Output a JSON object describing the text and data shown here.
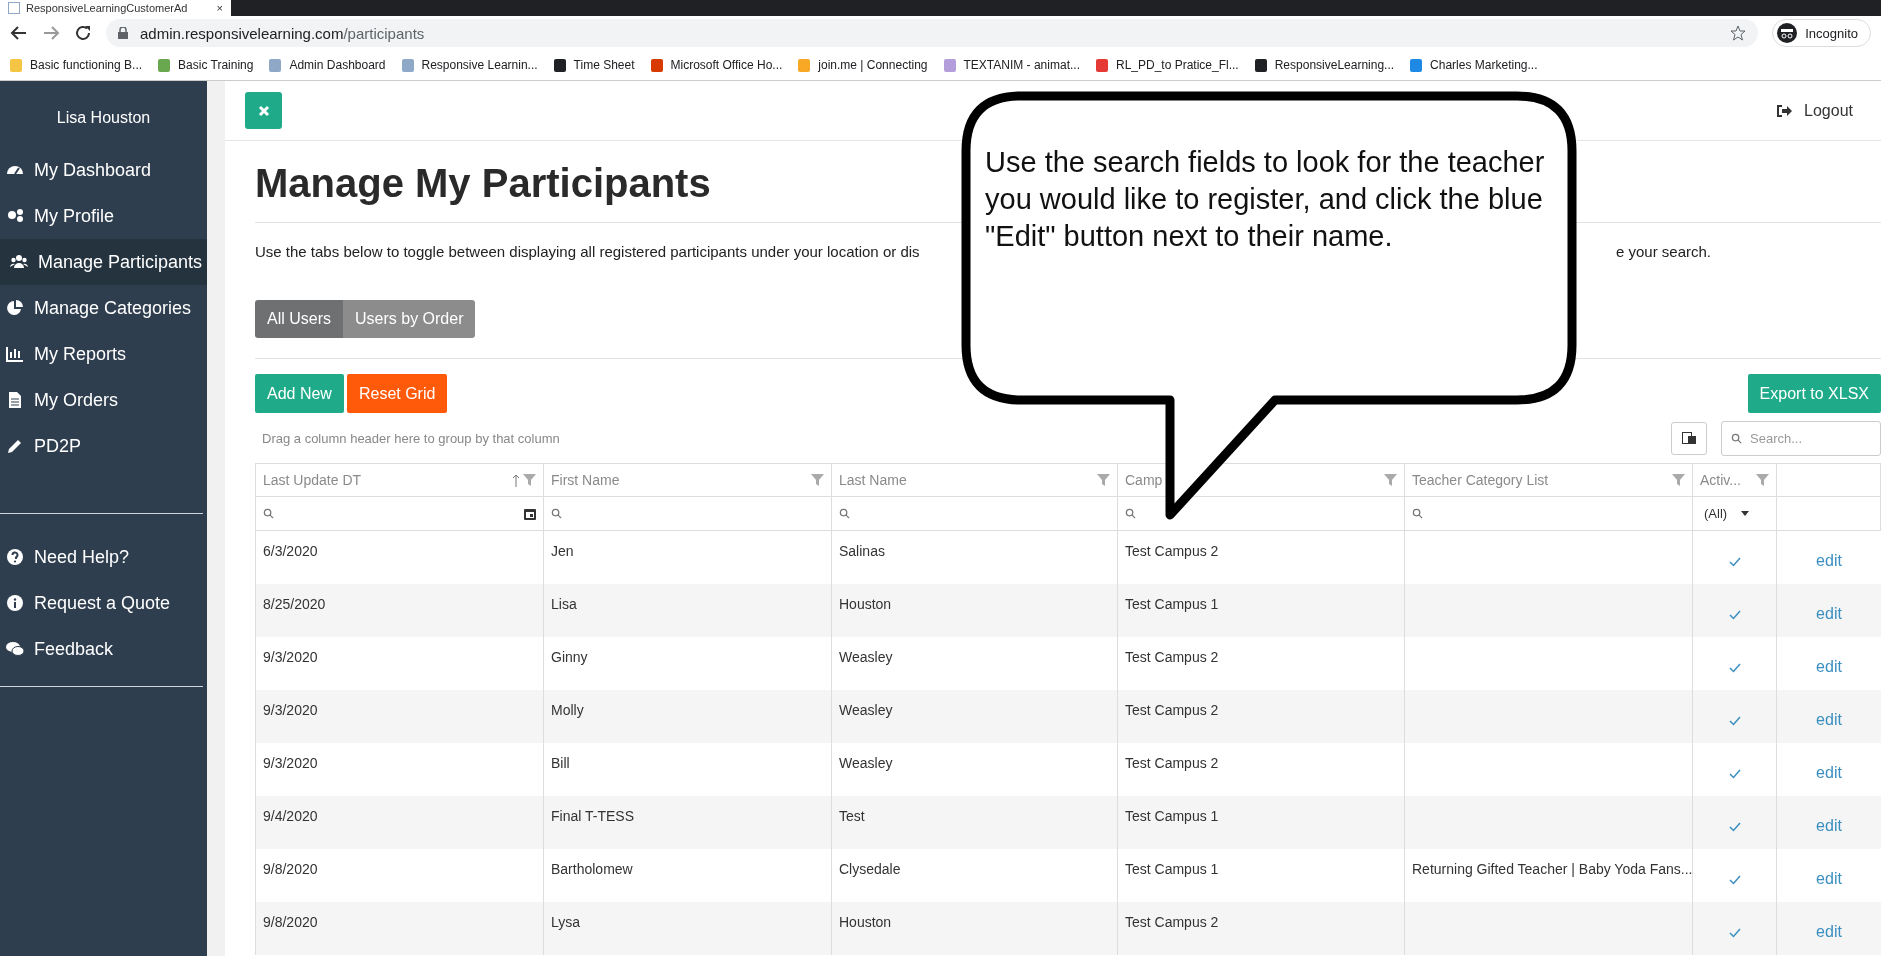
{
  "browser": {
    "tab_title": "ResponsiveLearningCustomerAd",
    "tab_close": "×",
    "url_host": "admin.responsivelearning.com",
    "url_path": "/participants",
    "profile": "Incognito",
    "bookmarks": [
      {
        "label": "Basic functioning B...",
        "color": "#f4c542"
      },
      {
        "label": "Basic Training",
        "color": "#6aa84f"
      },
      {
        "label": "Admin Dashboard",
        "color": "#8fa8c8"
      },
      {
        "label": "Responsive Learnin...",
        "color": "#8fa8c8"
      },
      {
        "label": "Time Sheet",
        "color": "#202124"
      },
      {
        "label": "Microsoft Office Ho...",
        "color": "#d83b01"
      },
      {
        "label": "join.me | Connecting",
        "color": "#f9a825"
      },
      {
        "label": "TEXTANIM - animat...",
        "color": "#b39ddb"
      },
      {
        "label": "RL_PD_to Pratice_Fl...",
        "color": "#e53935"
      },
      {
        "label": "ResponsiveLearning...",
        "color": "#202124"
      },
      {
        "label": "Charles Marketing...",
        "color": "#1e88e5"
      }
    ]
  },
  "sidebar": {
    "user": "Lisa Houston",
    "items": [
      {
        "label": "My Dashboard",
        "selected": false
      },
      {
        "label": "My Profile",
        "selected": false
      },
      {
        "label": "Manage Participants",
        "selected": true
      },
      {
        "label": "Manage Categories",
        "selected": false
      },
      {
        "label": "My Reports",
        "selected": false
      },
      {
        "label": "My Orders",
        "selected": false
      },
      {
        "label": "PD2P",
        "selected": false
      }
    ],
    "help_items": [
      {
        "label": "Need Help?"
      },
      {
        "label": "Request a Quote"
      },
      {
        "label": "Feedback"
      }
    ]
  },
  "header": {
    "logout": "Logout"
  },
  "page": {
    "title": "Manage My Participants",
    "intro_left": "Use the tabs below to toggle between displaying all registered participants under your location or dis",
    "intro_right": "e your search.",
    "tabs": [
      {
        "label": "All Users",
        "selected": true
      },
      {
        "label": "Users by Order",
        "selected": false
      }
    ],
    "buttons": {
      "add": "Add New",
      "reset": "Reset Grid",
      "export": "Export to XLSX"
    },
    "group_hint": "Drag a column header here to group by that column",
    "search_placeholder": "Search..."
  },
  "table": {
    "columns": [
      "Last Update DT",
      "First Name",
      "Last Name",
      "Camp",
      "Teacher Category List",
      "Activ..."
    ],
    "active_filter": "(All)",
    "rows": [
      {
        "date": "6/3/2020",
        "first": "Jen",
        "last": "Salinas",
        "campus": "Test Campus 2",
        "categories": "",
        "active": true,
        "action": "edit"
      },
      {
        "date": "8/25/2020",
        "first": "Lisa",
        "last": "Houston",
        "campus": "Test Campus 1",
        "categories": "",
        "active": true,
        "action": "edit"
      },
      {
        "date": "9/3/2020",
        "first": "Ginny",
        "last": "Weasley",
        "campus": "Test Campus 2",
        "categories": "",
        "active": true,
        "action": "edit"
      },
      {
        "date": "9/3/2020",
        "first": "Molly",
        "last": "Weasley",
        "campus": "Test Campus 2",
        "categories": "",
        "active": true,
        "action": "edit"
      },
      {
        "date": "9/3/2020",
        "first": "Bill",
        "last": "Weasley",
        "campus": "Test Campus 2",
        "categories": "",
        "active": true,
        "action": "edit"
      },
      {
        "date": "9/4/2020",
        "first": "Final T-TESS",
        "last": "Test",
        "campus": "Test Campus 1",
        "categories": "",
        "active": true,
        "action": "edit"
      },
      {
        "date": "9/8/2020",
        "first": "Bartholomew",
        "last": "Clysedale",
        "campus": "Test Campus 1",
        "categories": "Returning Gifted Teacher | Baby Yoda Fans...",
        "active": true,
        "action": "edit"
      },
      {
        "date": "9/8/2020",
        "first": "Lysa",
        "last": "Houston",
        "campus": "Test Campus 2",
        "categories": "",
        "active": true,
        "action": "edit"
      }
    ]
  },
  "callout": {
    "text": "Use the search fields to look for the teacher you would like to register, and click the blue \"Edit\" button next to their name."
  }
}
